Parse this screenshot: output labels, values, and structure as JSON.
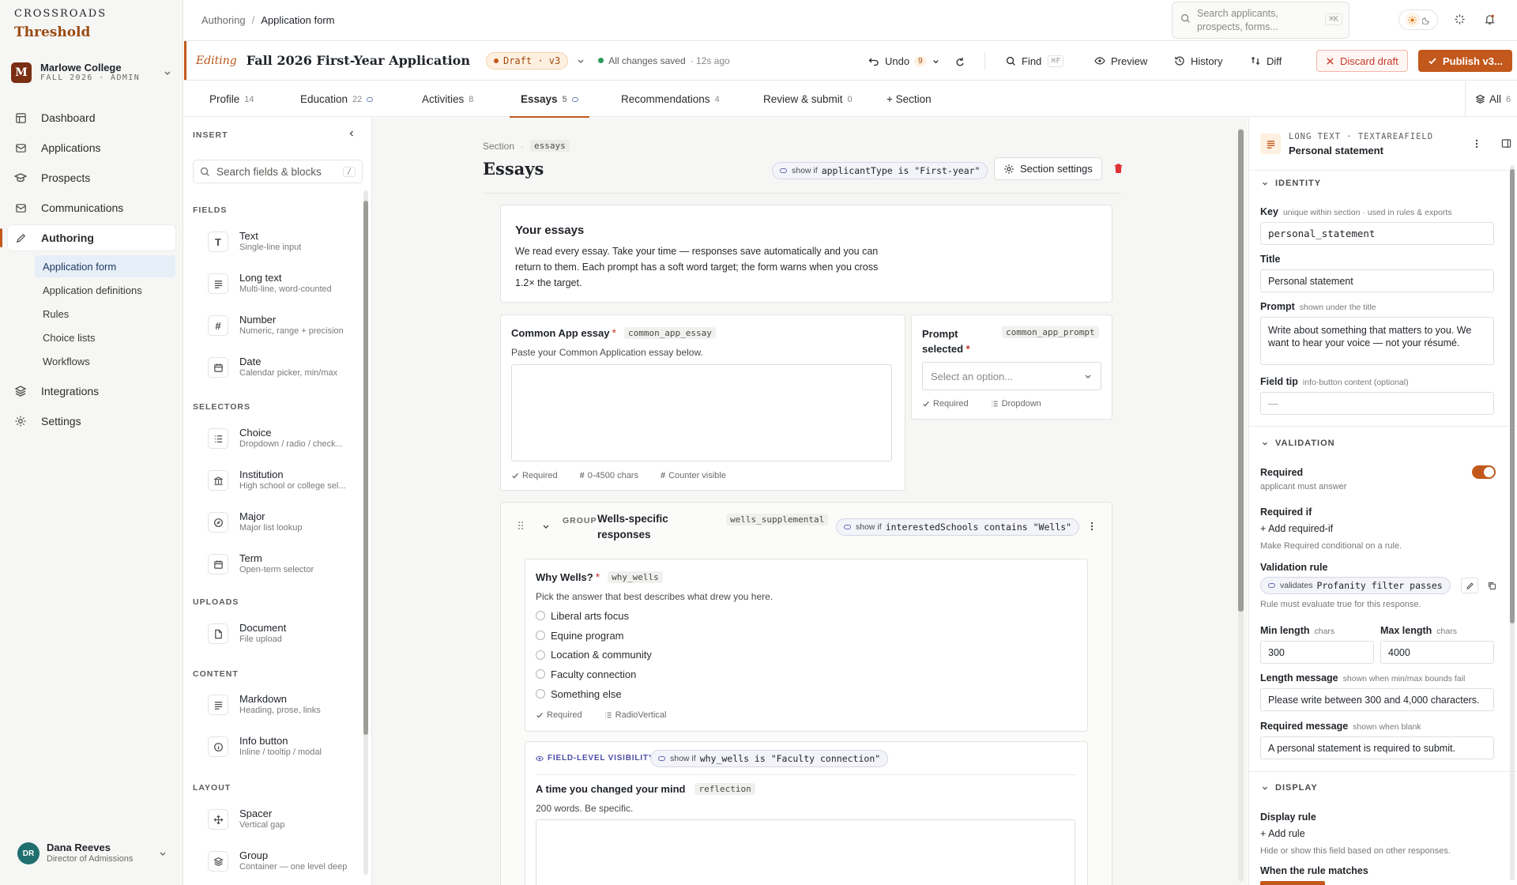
{
  "brand": {
    "name": "CROSSROADS",
    "product": "Threshold"
  },
  "org": {
    "initial": "M",
    "name": "Marlowe College",
    "sub": "FALL 2026 · ADMIN"
  },
  "nav": {
    "items": [
      "Dashboard",
      "Applications",
      "Prospects",
      "Communications",
      "Authoring",
      "Integrations",
      "Settings"
    ],
    "authoring_sub": [
      "Application form",
      "Application definitions",
      "Rules",
      "Choice lists",
      "Workflows"
    ]
  },
  "user": {
    "initials": "DR",
    "name": "Dana Reeves",
    "role": "Director of Admissions"
  },
  "topbar": {
    "crumb_parent": "Authoring",
    "crumb_current": "Application form",
    "search_placeholder": "Search applicants, prospects, forms...",
    "search_kbd": "⌘K"
  },
  "editbar": {
    "editing": "Editing",
    "title": "Fall 2026 First-Year Application",
    "draft": "Draft · v3",
    "saved": "All changes saved",
    "saved_ago": "· 12s ago",
    "undo": "Undo",
    "undo_count": "9",
    "find": "Find",
    "find_kbd": "⌘F",
    "preview": "Preview",
    "history": "History",
    "diff": "Diff",
    "discard": "Discard draft",
    "publish": "Publish v3..."
  },
  "tabs": [
    {
      "label": "Profile",
      "count": "14"
    },
    {
      "label": "Education",
      "count": "22"
    },
    {
      "label": "Activities",
      "count": "8"
    },
    {
      "label": "Essays",
      "count": "5"
    },
    {
      "label": "Recommendations",
      "count": "4"
    },
    {
      "label": "Review & submit",
      "count": "0"
    }
  ],
  "tab_add": "+ Section",
  "tab_all": {
    "label": "All",
    "count": "6"
  },
  "insert": {
    "title": "INSERT",
    "search": "Search fields & blocks",
    "search_kbd": "/",
    "groups": {
      "fields": "FIELDS",
      "selectors": "SELECTORS",
      "uploads": "UPLOADS",
      "content": "CONTENT",
      "layout": "LAYOUT"
    },
    "blocks": [
      {
        "title": "Text",
        "desc": "Single-line input",
        "icon": "T"
      },
      {
        "title": "Long text",
        "desc": "Multi-line, word-counted",
        "icon": "long-text-icon"
      },
      {
        "title": "Number",
        "desc": "Numeric, range + precision",
        "icon": "#"
      },
      {
        "title": "Date",
        "desc": "Calendar picker, min/max",
        "icon": "calendar-icon"
      },
      {
        "title": "Choice",
        "desc": "Dropdown / radio / check...",
        "icon": "list-icon"
      },
      {
        "title": "Institution",
        "desc": "High school or college sel...",
        "icon": "institution-icon"
      },
      {
        "title": "Major",
        "desc": "Major list lookup",
        "icon": "compass-icon"
      },
      {
        "title": "Term",
        "desc": "Open-term selector",
        "icon": "calendar-icon"
      },
      {
        "title": "Document",
        "desc": "File upload",
        "icon": "file-icon"
      },
      {
        "title": "Markdown",
        "desc": "Heading, prose, links",
        "icon": "markdown-icon"
      },
      {
        "title": "Info button",
        "desc": "Inline / tooltip / modal",
        "icon": "info-icon"
      },
      {
        "title": "Spacer",
        "desc": "Vertical gap",
        "icon": "move-icon"
      },
      {
        "title": "Group",
        "desc": "Container — one level deep",
        "icon": "layers-icon"
      }
    ]
  },
  "canvas": {
    "section_label": "Section",
    "section_key": "essays",
    "section_title": "Essays",
    "section_rule_prefix": "show if",
    "section_rule": "applicantType is \"First-year\"",
    "section_settings": "Section settings",
    "intro_title": "Your essays",
    "intro_body": "We read every essay. Take your time — responses save automatically and you can return to them. Each prompt has a soft word target; the form warns when you cross 1.2× the target.",
    "common": {
      "label": "Common App essay",
      "key": "common_app_essay",
      "hint": "Paste your Common Application essay below.",
      "meta": [
        "Required",
        "0-4500 chars",
        "Counter visible"
      ]
    },
    "prompt": {
      "label": "Prompt selected",
      "key": "common_app_prompt",
      "placeholder": "Select an option...",
      "meta": [
        "Required",
        "Dropdown"
      ]
    },
    "group": {
      "tag": "GROUP",
      "title": "Wells-specific responses",
      "key": "wells_supplemental",
      "rule_prefix": "show if",
      "rule": "interestedSchools contains \"Wells\""
    },
    "why": {
      "label": "Why Wells?",
      "key": "why_wells",
      "hint": "Pick the answer that best describes what drew you here.",
      "options": [
        "Liberal arts focus",
        "Equine program",
        "Location & community",
        "Faculty connection",
        "Something else"
      ],
      "meta": [
        "Required",
        "RadioVertical"
      ]
    },
    "reflection": {
      "vis_label": "FIELD-LEVEL VISIBILITY",
      "rule_prefix": "show if",
      "rule": "why_wells is \"Faculty connection\"",
      "label": "A time you changed your mind",
      "key": "reflection",
      "hint": "200 words. Be specific."
    }
  },
  "props": {
    "type": "LONG TEXT · TEXTAREAFIELD",
    "name": "Personal statement",
    "identity": "IDENTITY",
    "key_label": "Key",
    "key_hint": "unique within section · used in rules & exports",
    "key_value": "personal_statement",
    "title_label": "Title",
    "title_value": "Personal statement",
    "prompt_label": "Prompt",
    "prompt_hint": "shown under the title",
    "prompt_value": "Write about something that matters to you. We want to hear your voice — not your résumé.",
    "tip_label": "Field tip",
    "tip_hint": "info-button content (optional)",
    "tip_value": "—",
    "validation": "VALIDATION",
    "required_label": "Required",
    "required_hint": "applicant must answer",
    "required_on": true,
    "reqif_label": "Required if",
    "reqif_add": "+ Add required-if",
    "reqif_hint": "Make Required conditional on a rule.",
    "vrule_label": "Validation rule",
    "vrule_prefix": "validates",
    "vrule_value": "Profanity filter passes",
    "vrule_hint": "Rule must evaluate true for this response.",
    "min_label": "Min length",
    "min_unit": "chars",
    "min_value": "300",
    "max_label": "Max length",
    "max_unit": "chars",
    "max_value": "4000",
    "lenmsg_label": "Length message",
    "lenmsg_hint": "shown when min/max bounds fail",
    "lenmsg_value": "Please write between 300 and 4,000 characters.",
    "reqmsg_label": "Required message",
    "reqmsg_hint": "shown when blank",
    "reqmsg_value": "A personal statement is required to submit.",
    "display": "DISPLAY",
    "drule_label": "Display rule",
    "drule_add": "+ Add rule",
    "drule_hint": "Hide or show this field based on other responses.",
    "when_label": "When the rule matches"
  },
  "colors": {
    "accent": "#c2581b",
    "serif_brand": "#9a4b14",
    "active_sub": "#e6eef8"
  }
}
